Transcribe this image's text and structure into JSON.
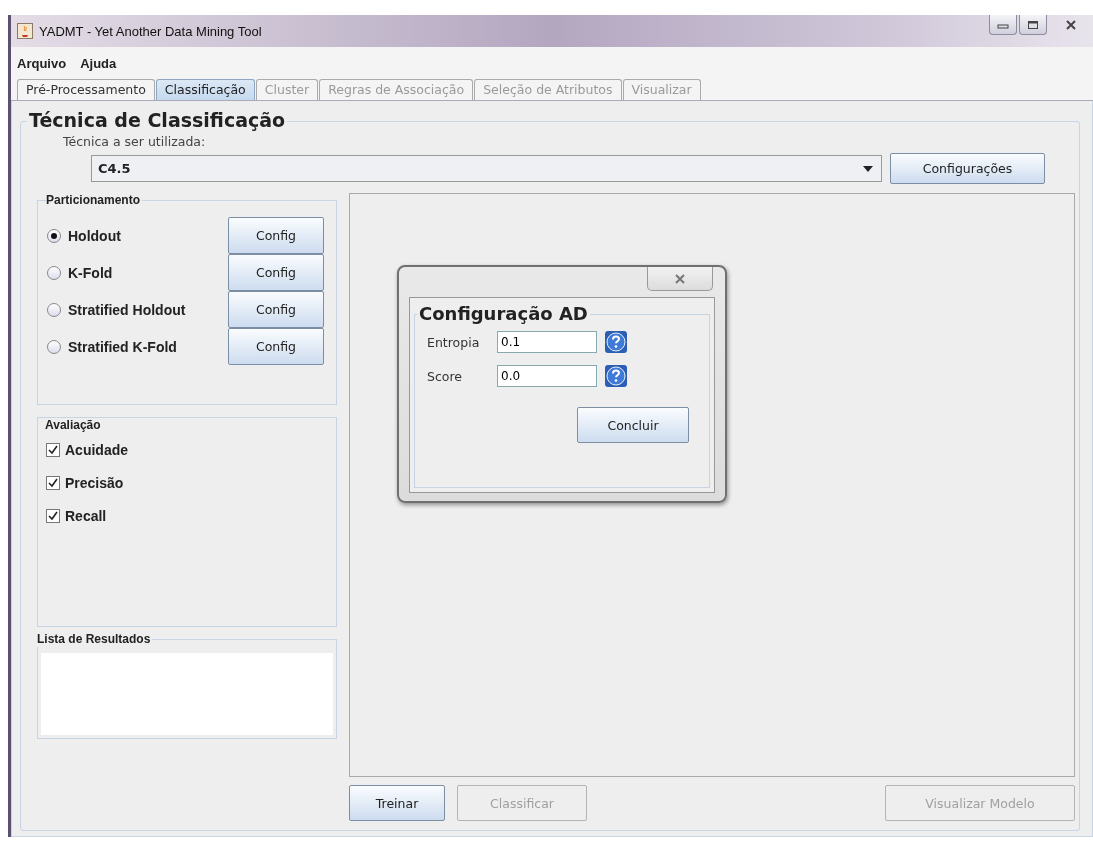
{
  "window": {
    "title": "YADMT - Yet Another Data Mining Tool"
  },
  "menu": [
    "Arquivo",
    "Ajuda"
  ],
  "tabs": [
    {
      "label": "Pré-Processamento",
      "selected": false,
      "disabled": false
    },
    {
      "label": "Classificação",
      "selected": true,
      "disabled": false
    },
    {
      "label": "Cluster",
      "selected": false,
      "disabled": true
    },
    {
      "label": "Regras de Associação",
      "selected": false,
      "disabled": true
    },
    {
      "label": "Seleção de Atributos",
      "selected": false,
      "disabled": true
    },
    {
      "label": "Visualizar",
      "selected": false,
      "disabled": true
    }
  ],
  "technique": {
    "title": "Técnica de Classificação",
    "label": "Técnica a ser utilizada:",
    "value": "C4.5",
    "button": "Configurações"
  },
  "partitioning": {
    "title": "Particionamento",
    "options": [
      {
        "label": "Holdout",
        "selected": true,
        "button": "Config"
      },
      {
        "label": "K-Fold",
        "selected": false,
        "button": "Config"
      },
      {
        "label": "Stratified Holdout",
        "selected": false,
        "button": "Config"
      },
      {
        "label": "Stratified K-Fold",
        "selected": false,
        "button": "Config"
      }
    ]
  },
  "evaluation": {
    "title": "Avaliação",
    "items": [
      {
        "label": "Acuidade",
        "checked": true
      },
      {
        "label": "Precisão",
        "checked": true
      },
      {
        "label": "Recall",
        "checked": true
      }
    ]
  },
  "results": {
    "title": "Lista de Resultados"
  },
  "actions": [
    {
      "label": "Treinar",
      "disabled": false
    },
    {
      "label": "Classificar",
      "disabled": true
    }
  ],
  "side_actions": [
    {
      "label": "Visualizar Modelo",
      "disabled": true
    }
  ],
  "dialog": {
    "title": "Configuração AD",
    "fields": [
      {
        "label": "Entropia",
        "value": "0.1"
      },
      {
        "label": "Score",
        "value": "0.0"
      }
    ],
    "button": "Concluir"
  }
}
